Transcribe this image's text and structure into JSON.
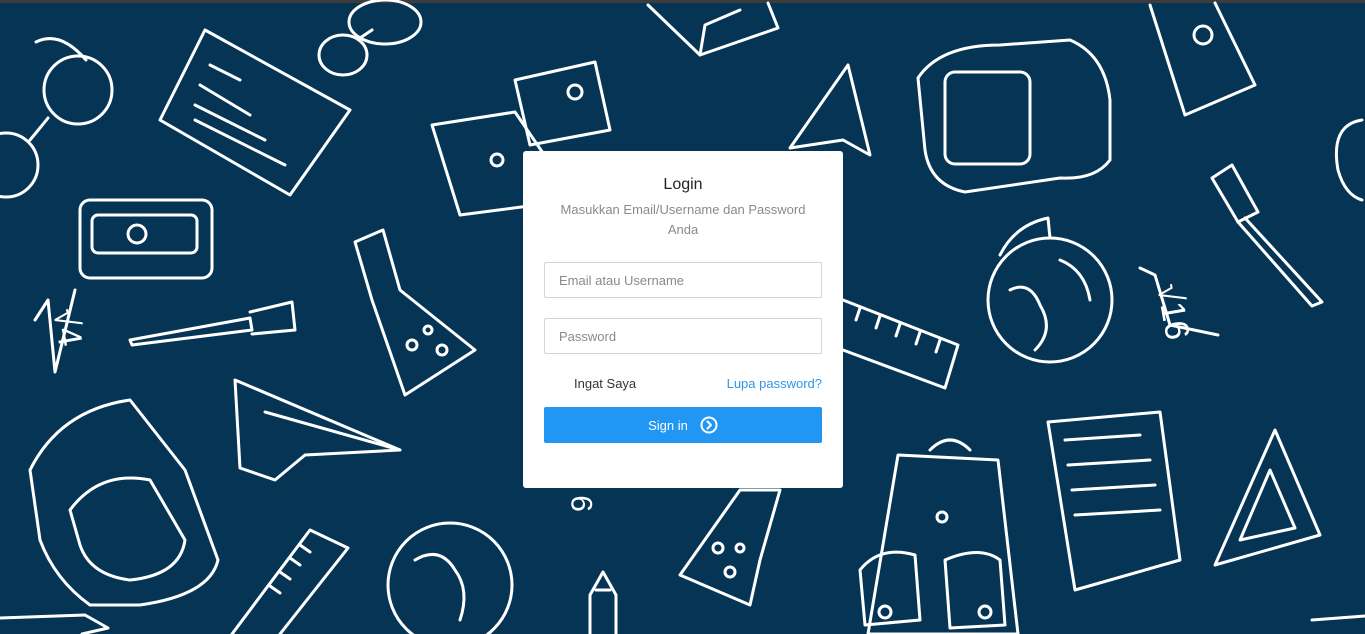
{
  "login": {
    "title": "Login",
    "subtitle": "Masukkan Email/Username dan Password Anda",
    "username_placeholder": "Email atau Username",
    "password_placeholder": "Password",
    "remember_label": "Ingat Saya",
    "forgot_label": "Lupa password?",
    "signin_label": "Sign in",
    "signin_icon": "chevron-right-circle-icon"
  },
  "background": {
    "color": "#063455",
    "doodle_text_1": "√4",
    "doodle_text_2": "√16",
    "doodle_text_3": "9"
  },
  "colors": {
    "accent": "#2196f3",
    "link": "#2e96eb"
  }
}
